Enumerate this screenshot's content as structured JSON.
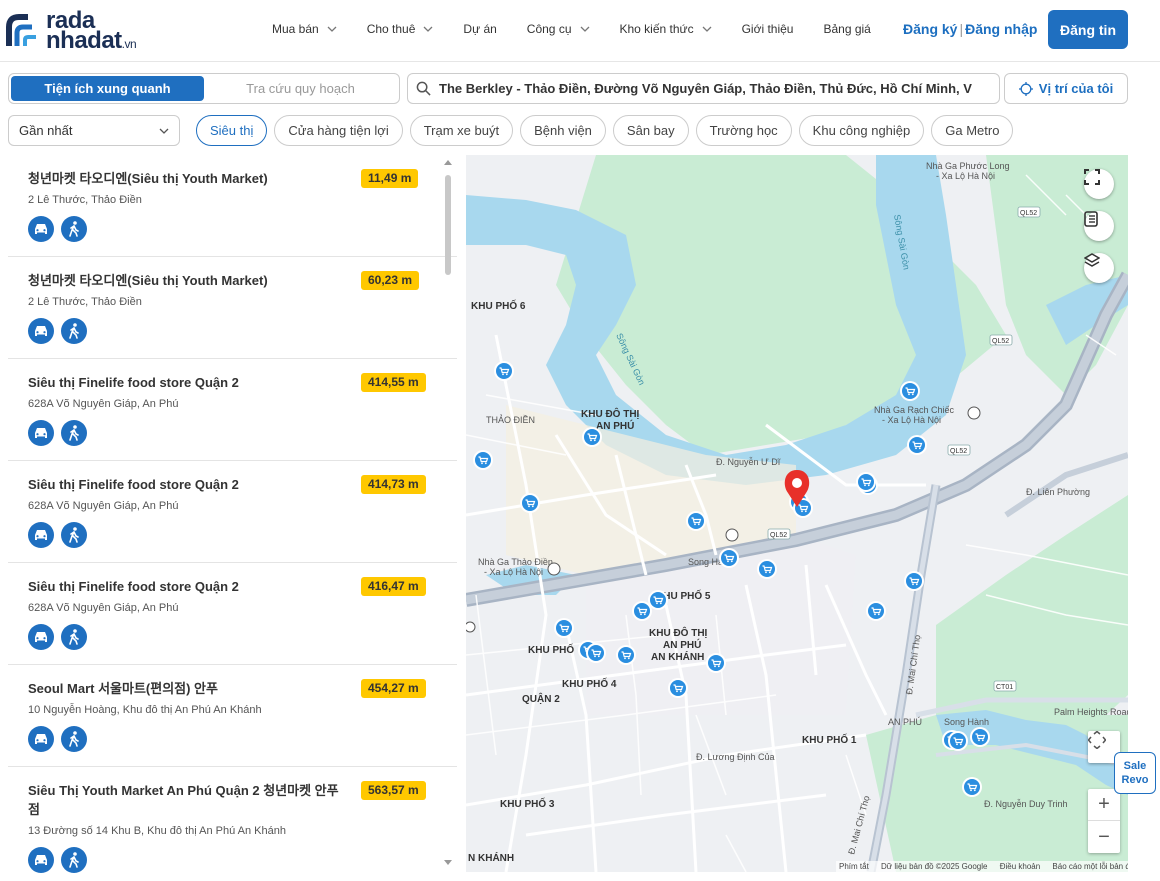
{
  "header": {
    "logo_top": "rada",
    "logo_bottom": "nhadat",
    "logo_suffix": ".vn",
    "nav": [
      "Mua bán",
      "Cho thuê",
      "Dự án",
      "Công cụ",
      "Kho kiến thức",
      "Giới thiệu",
      "Bảng giá"
    ],
    "nav_has_dropdown": [
      true,
      true,
      false,
      true,
      true,
      false,
      false
    ],
    "register": "Đăng ký",
    "separator": "|",
    "login": "Đăng nhập",
    "post": "Đăng tin"
  },
  "tabs": {
    "active": "Tiện ích xung quanh",
    "inactive": "Tra cứu quy hoạch"
  },
  "search": {
    "value": "The Berkley - Thảo Điền, Đường Võ Nguyên Giáp, Thảo Điền, Thủ Đức, Hồ Chí Minh, V",
    "locate": "Vị trí của tôi"
  },
  "sort": {
    "selected": "Gần nhất"
  },
  "categories": [
    "Siêu thị",
    "Cửa hàng tiện lợi",
    "Trạm xe buýt",
    "Bệnh viện",
    "Sân bay",
    "Trường học",
    "Khu công nghiệp",
    "Ga Metro"
  ],
  "active_category": "Siêu thị",
  "places": [
    {
      "name": "청년마켓 타오디엔(Siêu thị Youth Market)",
      "address": "2 Lê Thước, Thảo Điền",
      "distance": "11,49 m"
    },
    {
      "name": "청년마켓 타오디엔(Siêu thị Youth Market)",
      "address": "2 Lê Thước, Thảo Điền",
      "distance": "60,23 m"
    },
    {
      "name": "Siêu thị Finelife food store Quận 2",
      "address": "628A Võ Nguyên Giáp, An Phú",
      "distance": "414,55 m"
    },
    {
      "name": "Siêu thị Finelife food store Quận 2",
      "address": "628A Võ Nguyên Giáp, An Phú",
      "distance": "414,73 m"
    },
    {
      "name": "Siêu thị Finelife food store Quận 2",
      "address": "628A Võ Nguyên Giáp, An Phú",
      "distance": "416,47 m"
    },
    {
      "name": "Seoul Mart 서울마트(편의점) 안푸",
      "address": "10 Nguyễn Hoàng, Khu đô thị An Phú An Khánh",
      "distance": "454,27 m"
    },
    {
      "name": "Siêu Thị Youth Market An Phú Quận 2 청년마켓 안푸점",
      "address": "13 Đường số 14 Khu B, Khu đô thị An Phú An Khánh",
      "distance": "563,57 m"
    }
  ],
  "map": {
    "labels": {
      "ga_phuoc_long": "Nhà Ga Phước Long - Xa Lộ Hà Nội",
      "ga_rach_chiec": "Nhà Ga Rạch Chiếc - Xa Lộ Hà Nội",
      "ga_thao_dien": "Nhà Ga Thảo Điền - Xa Lộ Hà Nội",
      "song_sai_gon": "Sông Sài Gòn",
      "khu_pho_6": "KHU PHỐ 6",
      "kdt_an_phu": "KHU ĐÔ THỊ AN PHÚ",
      "thao_dien": "THẢO ĐIỀN",
      "kdt_an_phu_an_khanh": "KHU ĐÔ THỊ AN PHÚ AN KHÁNH",
      "khu_pho_5": "KHU PHỐ 5",
      "khu_pho_4": "KHU PHỐ 4",
      "khu_pho_3": "KHU PHỐ 3",
      "khu_pho_1": "KHU PHỐ 1",
      "quan_2": "QUẬN 2",
      "an_khanh": "AN KHÁNH",
      "an_phu": "AN PHÚ",
      "ql52": "QL52",
      "ct01": "CT01",
      "mai_chi_tho": "Đ. Mai Chí Thọ",
      "nguyen_duy_trinh": "Đ. Nguyễn Duy Trinh",
      "luong_dinh_cua": "Đ. Lương Định Của",
      "nguyen_u_di": "Đ. Nguyễn Ư Dĩ",
      "lien_phuong": "Đ. Liên Phường",
      "palm_heights": "Palm Heights Road",
      "song_hanh": "Song Hành"
    },
    "attribution": [
      "Phím tắt",
      "Dữ liệu bản đồ ©2025 Google",
      "Điều khoản",
      "Báo cáo một lỗi bản đồ"
    ],
    "zoom_in": "+",
    "zoom_out": "−"
  },
  "sale_badge": [
    "Sale",
    "Revo"
  ],
  "colors": {
    "primary": "#1f6fc0",
    "distance_badge": "#ffc800",
    "water": "#a8d8ee",
    "park": "#c9ecd4",
    "pin": "#e8302a"
  }
}
